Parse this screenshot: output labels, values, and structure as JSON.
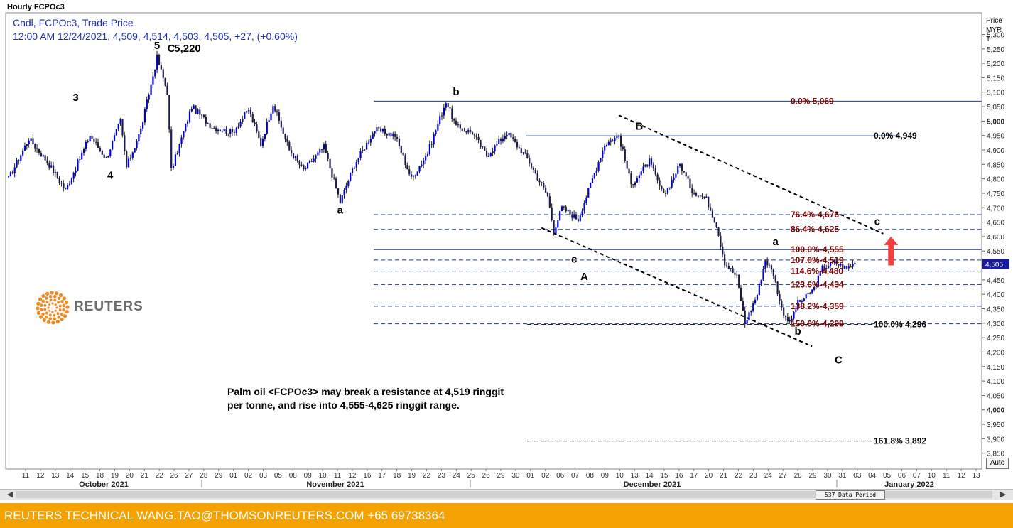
{
  "window_title": "Hourly FCPOc3",
  "header": {
    "line1": "Cndl, FCPOc3, Trade Price",
    "line2": "12:00 AM 12/24/2021, 4,509, 4,514, 4,503, 4,505, +27, (+0.60%)"
  },
  "price_axis": {
    "title_lines": [
      "Price",
      "MYR",
      "T"
    ],
    "current_label": "4,505",
    "auto_button": "Auto"
  },
  "caption": {
    "line1": "Palm oil <FCPOc3> may break a resistance at 4,519 ringgit",
    "line2": "per tonne, and rise into 4,555-4,625 ringgit range."
  },
  "logo": {
    "text": "REUTERS",
    "icon": "reuters-dot-ring-icon"
  },
  "scrollbar": {
    "data_period": "537 Data Period",
    "left_arrow": "◀",
    "right_arrow": "▶"
  },
  "footer": {
    "text": "REUTERS TECHNICAL  WANG.TAO@THOMSONREUTERS.COM  +65 69738364"
  },
  "colors": {
    "candle_up": "#0000cc",
    "candle_down": "#1a1a4d",
    "header_text": "#1f2fb3",
    "fib_text": "#7a0000",
    "level_line": "#1d3f7a",
    "arrow": "#f04040",
    "footer_bg": "#f5a100"
  },
  "chart_data": {
    "type": "candlestick",
    "title": "Hourly FCPOc3",
    "ylabel": "Price MYR T",
    "ylim": [
      3800,
      5370
    ],
    "y_ticks": [
      3850,
      3900,
      3950,
      4000,
      4050,
      4100,
      4150,
      4200,
      4250,
      4300,
      4350,
      4400,
      4450,
      4500,
      4550,
      4600,
      4650,
      4700,
      4750,
      4800,
      4850,
      4900,
      4950,
      5000,
      5050,
      5100,
      5150,
      5200,
      5250,
      5300
    ],
    "y_tick_labels": [
      "3,850",
      "3,900",
      "3,950",
      "4,000",
      "4,050",
      "4,100",
      "4,150",
      "4,200",
      "4,250",
      "4,300",
      "4,350",
      "4,400",
      "4,450",
      "4,500",
      "4,550",
      "4,600",
      "4,650",
      "4,700",
      "4,750",
      "4,800",
      "4,850",
      "4,900",
      "4,950",
      "5,000",
      "5,050",
      "5,100",
      "5,150",
      "5,200",
      "5,250",
      "5,300"
    ],
    "x_day_labels": [
      "11",
      "12",
      "13",
      "14",
      "15",
      "18",
      "19",
      "20",
      "21",
      "22",
      "26",
      "27",
      "28",
      "29",
      "01",
      "02",
      "03",
      "05",
      "08",
      "09",
      "10",
      "11",
      "12",
      "16",
      "17",
      "18",
      "19",
      "22",
      "23",
      "24",
      "25",
      "26",
      "29",
      "30",
      "01",
      "02",
      "06",
      "07",
      "08",
      "09",
      "10",
      "13",
      "14",
      "15",
      "16",
      "17",
      "20",
      "21",
      "22",
      "23",
      "24",
      "27",
      "28",
      "29",
      "30",
      "31",
      "03",
      "04",
      "05",
      "06",
      "07",
      "10",
      "11",
      "12",
      "13"
    ],
    "x_month_labels": [
      "October 2021",
      "November 2021",
      "December 2021",
      "January 2022"
    ],
    "price_path": [
      [
        0,
        4800
      ],
      [
        10,
        4940
      ],
      [
        20,
        4850
      ],
      [
        28,
        4760
      ],
      [
        40,
        4950
      ],
      [
        48,
        4870
      ],
      [
        55,
        5000
      ],
      [
        58,
        4840
      ],
      [
        65,
        4970
      ],
      [
        73,
        5220
      ],
      [
        78,
        5100
      ],
      [
        80,
        4830
      ],
      [
        90,
        5050
      ],
      [
        100,
        4980
      ],
      [
        110,
        4960
      ],
      [
        118,
        5040
      ],
      [
        124,
        4920
      ],
      [
        130,
        5060
      ],
      [
        138,
        4900
      ],
      [
        145,
        4830
      ],
      [
        155,
        4910
      ],
      [
        163,
        4720
      ],
      [
        170,
        4850
      ],
      [
        180,
        4970
      ],
      [
        190,
        4950
      ],
      [
        198,
        4800
      ],
      [
        206,
        4890
      ],
      [
        215,
        5069
      ],
      [
        220,
        4980
      ],
      [
        228,
        4960
      ],
      [
        235,
        4880
      ],
      [
        245,
        4960
      ],
      [
        255,
        4870
      ],
      [
        265,
        4740
      ],
      [
        268,
        4620
      ],
      [
        272,
        4700
      ],
      [
        280,
        4660
      ],
      [
        285,
        4760
      ],
      [
        293,
        4920
      ],
      [
        300,
        4949
      ],
      [
        306,
        4780
      ],
      [
        315,
        4860
      ],
      [
        322,
        4740
      ],
      [
        330,
        4850
      ],
      [
        336,
        4760
      ],
      [
        343,
        4730
      ],
      [
        348,
        4640
      ],
      [
        352,
        4510
      ],
      [
        358,
        4460
      ],
      [
        362,
        4300
      ],
      [
        368,
        4400
      ],
      [
        372,
        4520
      ],
      [
        376,
        4470
      ],
      [
        380,
        4350
      ],
      [
        384,
        4300
      ],
      [
        388,
        4370
      ],
      [
        392,
        4390
      ],
      [
        396,
        4420
      ],
      [
        400,
        4490
      ],
      [
        406,
        4510
      ],
      [
        412,
        4490
      ],
      [
        416,
        4509
      ]
    ],
    "wave_labels": [
      {
        "label": "5",
        "x": 73,
        "y": 5250
      },
      {
        "label": "C",
        "x": 80,
        "y": 5240
      },
      {
        "label": "5,220",
        "x": 88,
        "y": 5240
      },
      {
        "label": "3",
        "x": 33,
        "y": 5070
      },
      {
        "label": "4",
        "x": 50,
        "y": 4800
      },
      {
        "label": "a",
        "x": 163,
        "y": 4680
      },
      {
        "label": "b",
        "x": 220,
        "y": 5090
      },
      {
        "label": "c",
        "x": 278,
        "y": 4510
      },
      {
        "label": "A",
        "x": 283,
        "y": 4450
      },
      {
        "label": "B",
        "x": 310,
        "y": 4970
      },
      {
        "label": "a",
        "x": 377,
        "y": 4570
      },
      {
        "label": "b",
        "x": 388,
        "y": 4260
      },
      {
        "label": "c",
        "x": 427,
        "y": 4640
      },
      {
        "label": "C",
        "x": 408,
        "y": 4160
      }
    ],
    "retracement_set_1": {
      "start_label": "0.0%",
      "start_value": "5,069",
      "levels": [
        {
          "pct": "76.4%",
          "value": "4,676",
          "price": 4676
        },
        {
          "pct": "86.4%",
          "value": "4,625",
          "price": 4625
        },
        {
          "pct": "100.0%",
          "value": "4,555",
          "price": 4555
        },
        {
          "pct": "107.0%",
          "value": "4,519",
          "price": 4519
        },
        {
          "pct": "114.6%",
          "value": "4,480",
          "price": 4480
        },
        {
          "pct": "123.6%",
          "value": "4,434",
          "price": 4434
        },
        {
          "pct": "138.2%",
          "value": "4,359",
          "price": 4359
        },
        {
          "pct": "150.0%",
          "value": "4,298",
          "price": 4298
        }
      ]
    },
    "retracement_set_2": {
      "start_label": "0.0%",
      "start_value": "4,949",
      "levels": [
        {
          "pct": "100.0%",
          "value": "4,296",
          "price": 4296
        },
        {
          "pct": "161.8%",
          "value": "3,892",
          "price": 3892
        }
      ]
    },
    "channel": {
      "upper": [
        [
          300,
          5020
        ],
        [
          430,
          4610
        ]
      ],
      "lower": [
        [
          262,
          4630
        ],
        [
          395,
          4220
        ]
      ]
    },
    "annotation_arrow": {
      "x": 431,
      "from": 4500,
      "to": 4600
    }
  }
}
